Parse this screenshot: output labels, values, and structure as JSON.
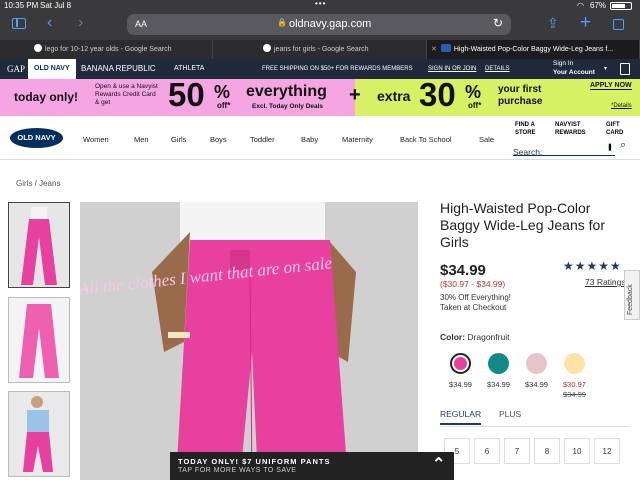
{
  "status": {
    "time": "10:35 PM",
    "date": "Sat Jul 8",
    "battery": "67%"
  },
  "browser": {
    "aa_label": "AA",
    "url": "oldnavy.gap.com",
    "tabs": [
      {
        "title": "lego for 10-12 year olds - Google Search"
      },
      {
        "title": "jeans for girls - Google Search"
      },
      {
        "title": "High-Waisted Pop-Color Baggy Wide-Leg Jeans f..."
      }
    ]
  },
  "brandbar": {
    "brands": [
      "GAP",
      "OLD NAVY",
      "BANANA REPUBLIC",
      "ATHLETA"
    ],
    "shipping": "FREE SHIPPING ON $50+ FOR REWARDS MEMBERS",
    "signin": "SIGN IN OR JOIN",
    "details": "DETAILS",
    "signin_label": "Sign In",
    "account": "Your Account"
  },
  "promo": {
    "today_only": "today only!",
    "card_text": "Open & use a Navyist Rewards Credit Card & get",
    "pct50": "50",
    "off": "off*",
    "everything": "everything",
    "excl": "Excl. Today Only Deals",
    "plus": "+",
    "extra": "extra",
    "pct30": "30",
    "first_purchase": "your first purchase",
    "apply": "APPLY NOW",
    "details": "*Details"
  },
  "nav": {
    "logo": "OLD NAVY",
    "items": [
      "Women",
      "Men",
      "Girls",
      "Boys",
      "Toddler",
      "Baby",
      "Maternity",
      "Back To School",
      "Sale"
    ],
    "find_store": "FIND A STORE",
    "rewards": "NAVYIST REWARDS",
    "gift": "GIFT CARD",
    "search_label": "Search:"
  },
  "breadcrumb": "Girls / Jeans",
  "overlay_text": "All the clothes I want that are on sale",
  "product": {
    "title": "High-Waisted Pop-Color Baggy Wide-Leg Jeans for Girls",
    "price": "$34.99",
    "price_range": "($30.97 - $34.99)",
    "promo_line1": "30% Off Everything!",
    "promo_line2": "Taken at Checkout",
    "rating_count": "73 Ratings",
    "color_label": "Color:",
    "color_name": "Dragonfruit",
    "swatches": [
      {
        "color": "#e8409e",
        "price": "$34.99",
        "old": ""
      },
      {
        "color": "#138a8a",
        "price": "$34.99",
        "old": ""
      },
      {
        "color": "#e8c3c8",
        "price": "$34.99",
        "old": ""
      },
      {
        "color": "#fde3a7",
        "price": "$30.97",
        "old": "$34.99"
      }
    ],
    "fit_tabs": [
      "REGULAR",
      "PLUS"
    ],
    "sizes": [
      "5",
      "6",
      "7",
      "8",
      "10",
      "12"
    ]
  },
  "feedback": "Feedback",
  "banner": {
    "line1": "TODAY ONLY! $7 UNIFORM PANTS",
    "line2": "TAP FOR MORE WAYS TO SAVE"
  }
}
